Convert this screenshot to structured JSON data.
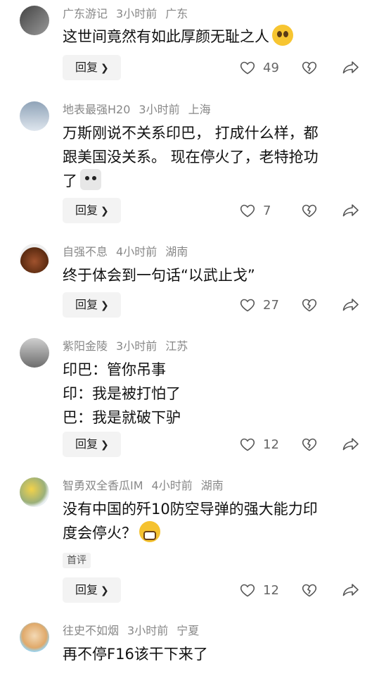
{
  "comments": [
    {
      "username": "广东游记",
      "time": "3小时前",
      "location": "广东",
      "lines": [
        "这世间竟然有如此厚颜无耻之人"
      ],
      "emoji": "pleading-face",
      "reply_label": "回复",
      "likes": "49"
    },
    {
      "username": "地表最强H20",
      "time": "3小时前",
      "location": "上海",
      "lines": [
        "万斯刚说不关系印巴， 打成什么样，都",
        "跟美国没关系。 现在停火了，老特抢功",
        "了"
      ],
      "emoji": "dog-face",
      "reply_label": "回复",
      "likes": "7"
    },
    {
      "username": "自强不息",
      "time": "4小时前",
      "location": "湖南",
      "lines": [
        "终于体会到一句话“以武止戈”"
      ],
      "reply_label": "回复",
      "likes": "27"
    },
    {
      "username": "紫阳金陵",
      "time": "3小时前",
      "location": "江苏",
      "lines": [
        "印巴：管你吊事",
        "印：我是被打怕了",
        "巴：我是就破下驴"
      ],
      "reply_label": "回复",
      "likes": "12"
    },
    {
      "username": "智勇双全香瓜IM",
      "time": "4小时前",
      "location": "湖南",
      "lines": [
        "没有中国的歼10防空导弹的强大能力印",
        "度会停火？"
      ],
      "emoji": "grinning-face",
      "tag": "首评",
      "reply_label": "回复",
      "likes": "12"
    },
    {
      "username": "往史不如烟",
      "time": "3小时前",
      "location": "宁夏",
      "lines": [
        "再不停F16该干下来了"
      ]
    }
  ],
  "colors": {
    "meta_text": "#888888",
    "reply_bg": "#f3f3f3",
    "icon_stroke": "#555555"
  }
}
